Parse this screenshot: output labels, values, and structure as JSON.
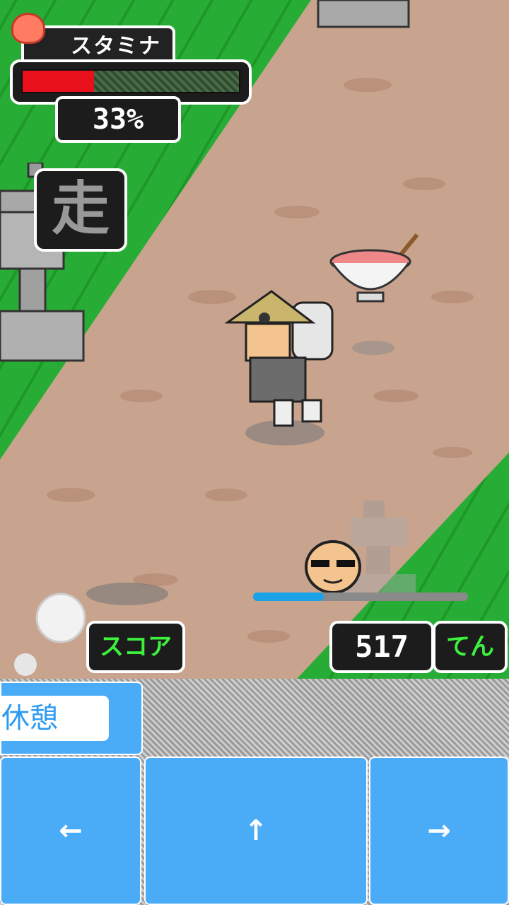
{
  "hud": {
    "stamina_label": "スタミナ",
    "stamina_percent_text": "33%",
    "stamina_fraction": 0.33,
    "location_kanji": "走"
  },
  "score": {
    "label": "スコア",
    "value": "517",
    "unit": "てん"
  },
  "progress": {
    "fraction": 0.33
  },
  "controls": {
    "rest_label": "休憩",
    "left_label": "←",
    "up_label": "↑",
    "right_label": "→"
  },
  "colors": {
    "grass": "#27ad35",
    "path": "#c8a38e",
    "stamina_fill": "#e8111b",
    "score_text": "#3ef03e",
    "button_blue": "#4aabf7",
    "progress_blue": "#1aa2e6"
  }
}
